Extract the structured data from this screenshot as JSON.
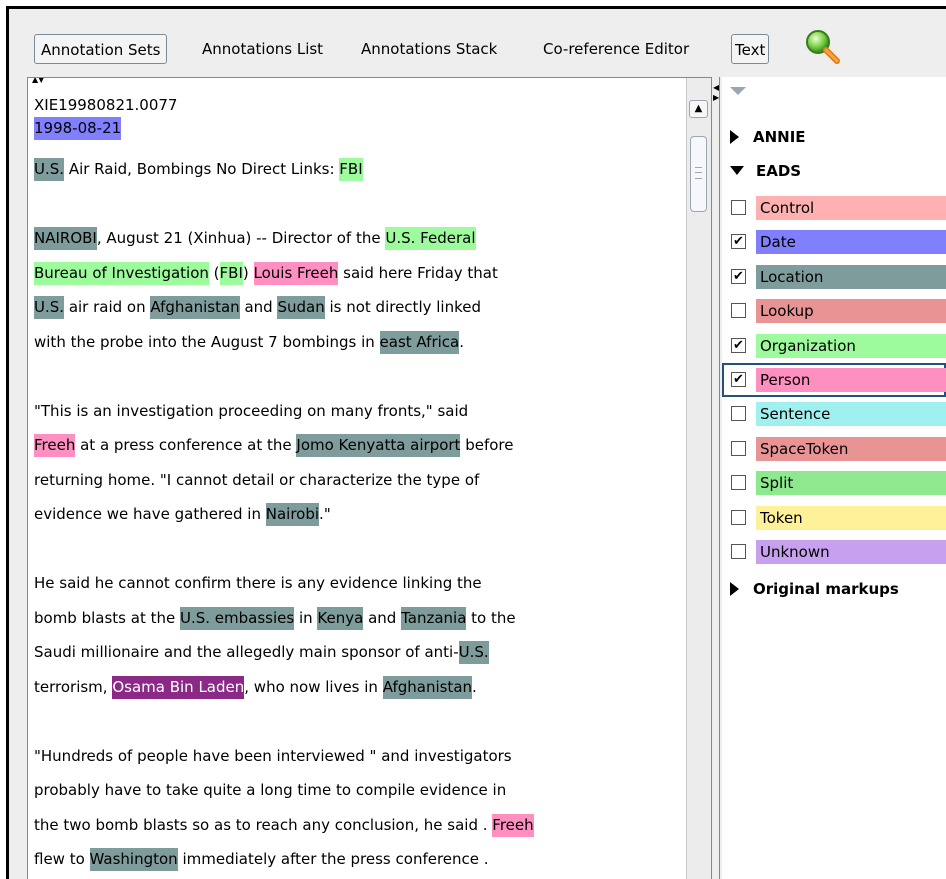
{
  "toolbar": {
    "annotation_sets": "Annotation Sets",
    "annotations_list": "Annotations List",
    "annotations_stack": "Annotations Stack",
    "coreference_editor": "Co-reference Editor",
    "text": "Text",
    "search_icon": "magnifier-icon"
  },
  "document": {
    "id_line": "XIE19980821.0077",
    "date_line": "1998-08-21",
    "headline": {
      "loc": "U.S.",
      "mid": " Air Raid, Bombings No Direct Links: ",
      "org": "FBI"
    },
    "para1": {
      "l1": {
        "loc": "NAIROBI",
        "a": ", August 21 (Xinhua) -- Director of the ",
        "org": "U.S. Federal"
      },
      "l2": {
        "org1": "Bureau of Investigation",
        "a": " (",
        "org2": "FBI",
        "b": ") ",
        "per": "Louis Freeh",
        "c": " said here Friday that"
      },
      "l3": {
        "loc1": "U.S.",
        "a": " air raid on ",
        "loc2": "Afghanistan",
        "b": " and ",
        "loc3": "Sudan",
        "c": " is not directly linked"
      },
      "l4": {
        "a": "with the probe into the August 7 bombings in ",
        "loc": "east Africa",
        "b": "."
      }
    },
    "para2": {
      "l1": "\"This is an investigation proceeding on many fronts,\" said",
      "l2": {
        "per": "Freeh",
        "a": " at a press conference at the ",
        "loc": "Jomo Kenyatta airport",
        "b": " before"
      },
      "l3": "returning home. \"I cannot detail or characterize the type of",
      "l4": {
        "a": "evidence we have gathered in ",
        "loc": "Nairobi",
        "b": ".\""
      }
    },
    "para3": {
      "l1": "He said he cannot confirm there is any evidence linking the",
      "l2": {
        "a": "bomb blasts at the ",
        "loc1": "U.S. embassies",
        "b": " in ",
        "loc2": "Kenya",
        "c": " and ",
        "loc3": "Tanzania",
        "d": " to the"
      },
      "l3": {
        "a": "Saudi millionaire and the allegedly main sponsor of anti-",
        "loc": "U.S."
      },
      "l4": {
        "a": "terrorism, ",
        "dark": "Osama Bin Laden",
        "b": ", who now lives in ",
        "loc": "Afghanistan",
        "c": "."
      }
    },
    "para4": {
      "l1": "\"Hundreds of people have been interviewed \" and investigators",
      "l2": "probably have to take quite a long time to compile evidence in",
      "l3": {
        "a": "the two bomb blasts so as to reach any conclusion, he said . ",
        "per": "Freeh"
      },
      "l4": {
        "a": "flew to ",
        "loc": "Washington",
        "b": " immediately after the press conference ."
      }
    }
  },
  "sets_panel": {
    "annie": "ANNIE",
    "eads": "EADS",
    "original_markups": "Original markups",
    "types": [
      {
        "label": "Control",
        "checked": false,
        "color": "#ffb0b0"
      },
      {
        "label": "Date",
        "checked": true,
        "color": "#8080ff"
      },
      {
        "label": "Location",
        "checked": true,
        "color": "#7f9c9c"
      },
      {
        "label": "Lookup",
        "checked": false,
        "color": "#e89494"
      },
      {
        "label": "Organization",
        "checked": true,
        "color": "#9dfb9d"
      },
      {
        "label": "Person",
        "checked": true,
        "color": "#ff8fc1"
      },
      {
        "label": "Sentence",
        "checked": false,
        "color": "#a0f0f0"
      },
      {
        "label": "SpaceToken",
        "checked": false,
        "color": "#e89494"
      },
      {
        "label": "Split",
        "checked": false,
        "color": "#8ee88e"
      },
      {
        "label": "Token",
        "checked": false,
        "color": "#fff09a"
      },
      {
        "label": "Unknown",
        "checked": false,
        "color": "#c8a0f0"
      }
    ]
  },
  "checkmark": "✔"
}
